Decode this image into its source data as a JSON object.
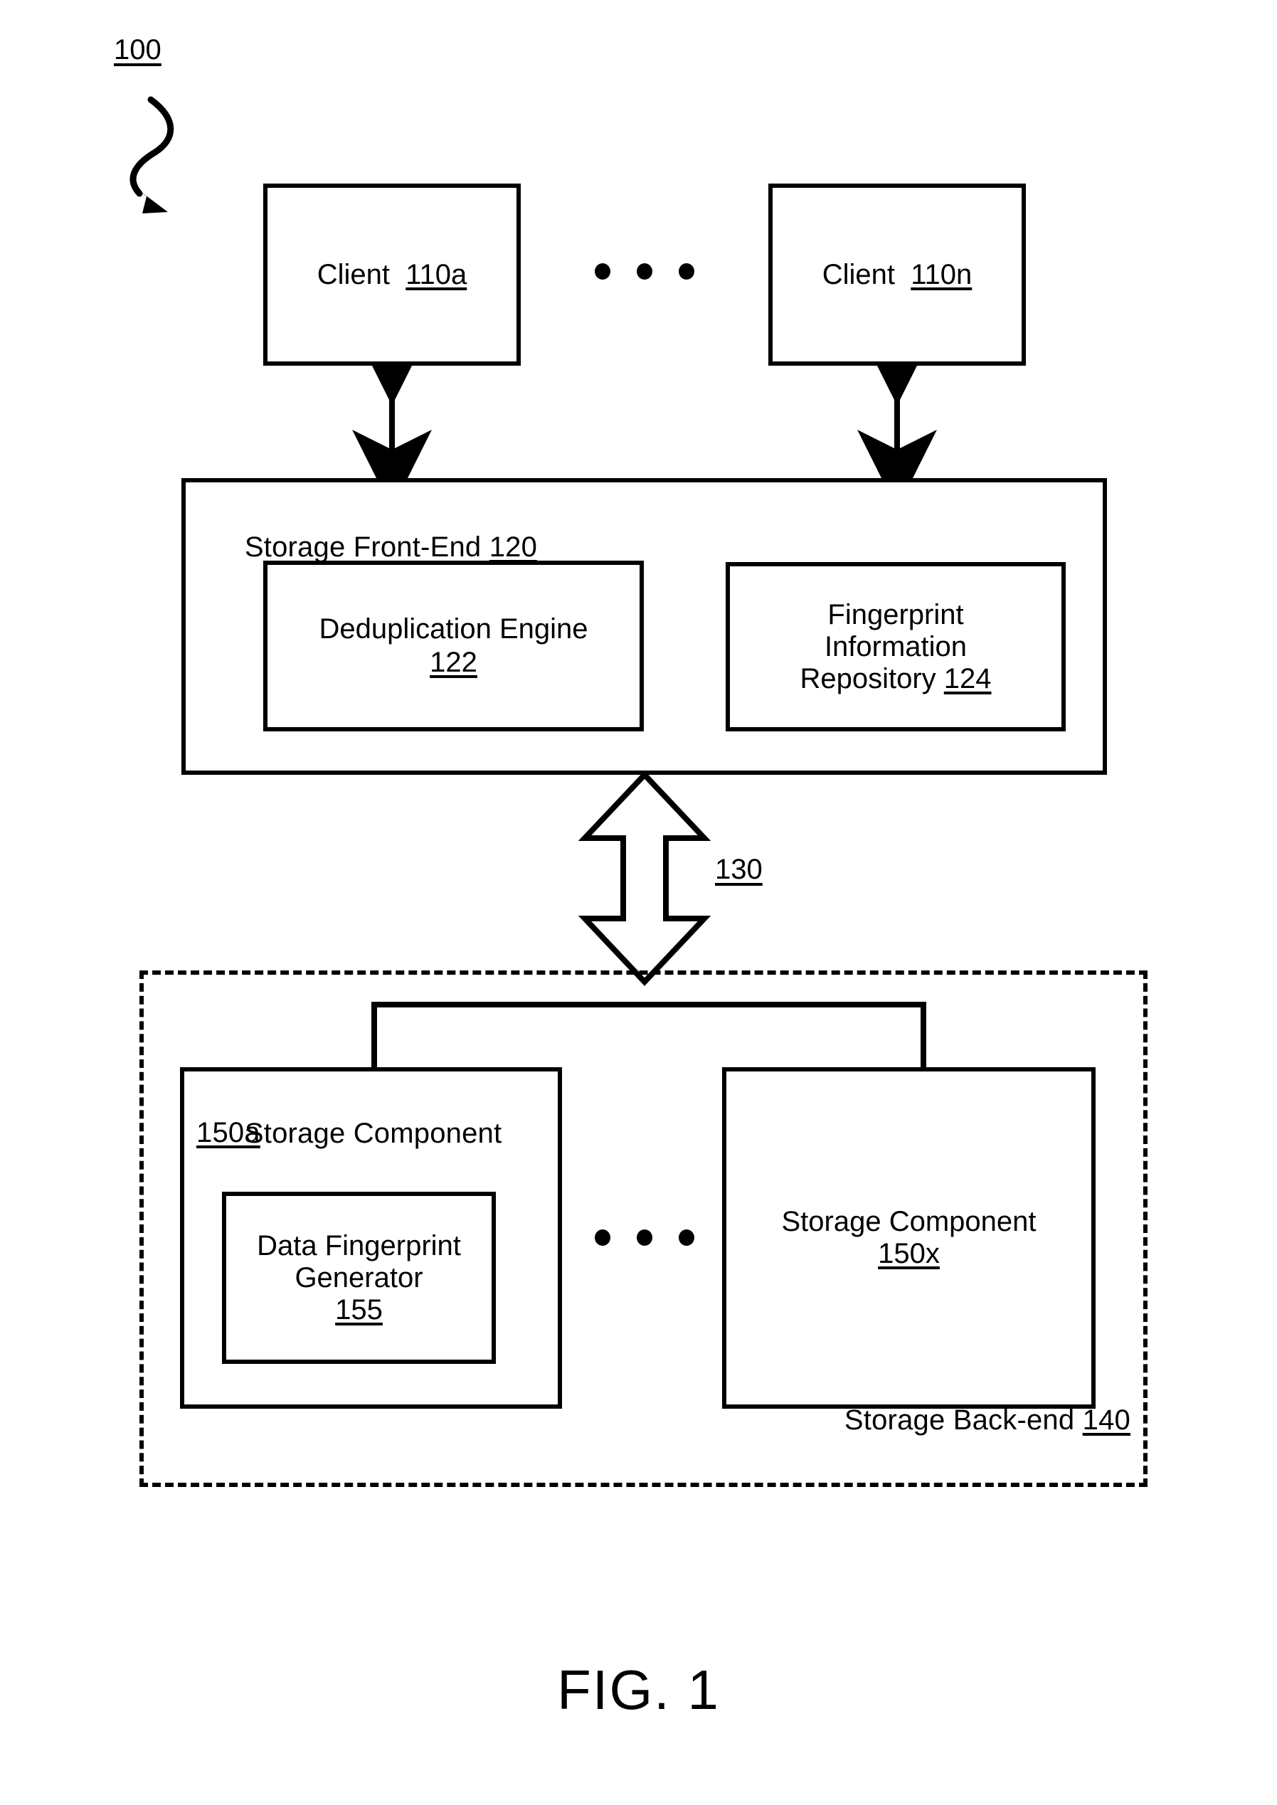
{
  "figure": {
    "caption": "FIG. 1",
    "system_ref": "100",
    "ellipsis_dots": 3
  },
  "clients": {
    "first": {
      "label": "Client",
      "ref": "110a"
    },
    "last": {
      "label": "Client",
      "ref": "110n"
    }
  },
  "front_end": {
    "label": "Storage Front-End",
    "ref": "120",
    "modules": [
      {
        "title": "Deduplication Engine",
        "ref": "122"
      },
      {
        "title_line1": "Fingerprint",
        "title_line2": "Information",
        "title_line3": "Repository",
        "ref": "124"
      }
    ]
  },
  "interconnect": {
    "ref": "130"
  },
  "back_end": {
    "label": "Storage Back-end",
    "ref": "140",
    "components": {
      "first": {
        "label_line1": "Storage Component",
        "ref": "150a",
        "module": {
          "title_line1": "Data Fingerprint",
          "title_line2": "Generator",
          "ref": "155"
        }
      },
      "last": {
        "label": "Storage Component",
        "ref": "150x"
      }
    }
  },
  "colors": {
    "stroke": "#000000",
    "background": "#ffffff"
  }
}
